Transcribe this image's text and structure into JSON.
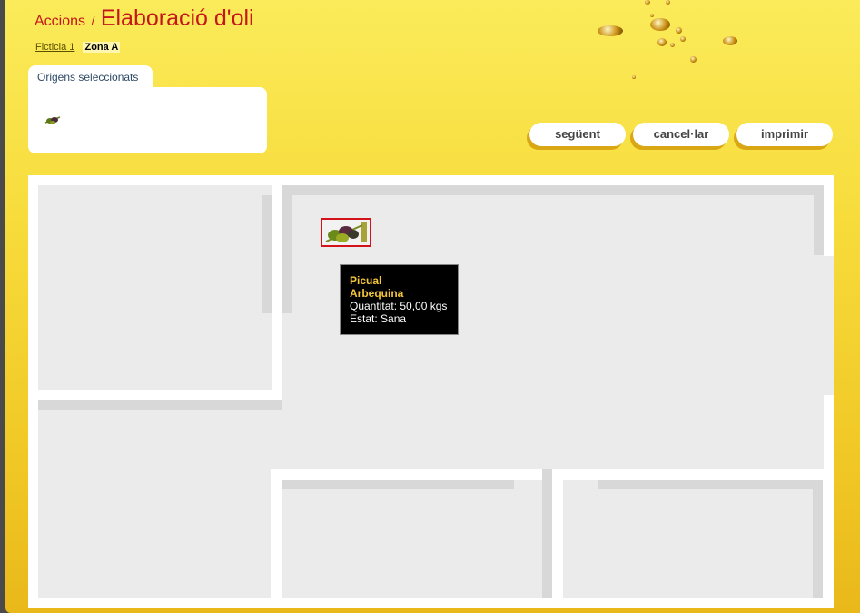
{
  "breadcrumb": {
    "root": "Accions",
    "separator": "/",
    "title": "Elaboració d'oli"
  },
  "sub_breadcrumb": {
    "link": "Ficticia 1",
    "current": "Zona A"
  },
  "origins_panel": {
    "tab_label": "Origens seleccionats",
    "items": [
      {
        "icon": "olives-icon"
      }
    ]
  },
  "actions": {
    "next": "següent",
    "cancel": "cancel·lar",
    "print": "imprimir"
  },
  "map": {
    "marker": {
      "icon": "olives-icon",
      "selected": true
    },
    "tooltip": {
      "varieties": [
        "Picual",
        "Arbequina"
      ],
      "quantity": "Quantitat: 50,00 kgs",
      "state": "Estat: Sana"
    }
  },
  "colors": {
    "accent_red": "#c4171a",
    "background_yellow": "#f7dc3c",
    "tooltip_highlight": "#f3c53a"
  }
}
